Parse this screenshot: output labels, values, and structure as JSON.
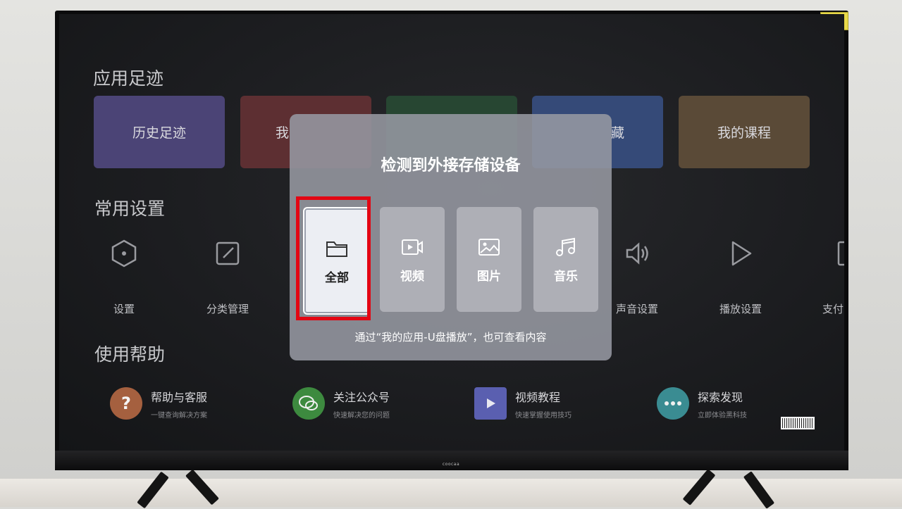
{
  "sections": {
    "recent": "应用足迹",
    "settings": "常用设置",
    "help": "使用帮助"
  },
  "recent_cards": [
    {
      "label": "历史足迹",
      "color": "#4b4476"
    },
    {
      "label": "我",
      "color": "#5d2f32"
    },
    {
      "label": "",
      "color": "#274632"
    },
    {
      "label": "藏",
      "color": "#354a78"
    },
    {
      "label": "我的课程",
      "color": "#5a4a37"
    }
  ],
  "settings_items": [
    {
      "label": "设置",
      "icon": "hexagon-icon"
    },
    {
      "label": "分类管理",
      "icon": "edit-square-icon"
    },
    {
      "label": "声音设置",
      "icon": "speaker-icon"
    },
    {
      "label": "播放设置",
      "icon": "play-icon"
    },
    {
      "label": "支付",
      "icon": "payment-icon"
    }
  ],
  "help_items": [
    {
      "title": "帮助与客服",
      "subtitle": "一键查询解决方案",
      "icon": "question-icon",
      "color": "#a5603f"
    },
    {
      "title": "关注公众号",
      "subtitle": "快速解决您的问题",
      "icon": "wechat-icon",
      "color": "#3d8a3f"
    },
    {
      "title": "视频教程",
      "subtitle": "快速掌握使用技巧",
      "icon": "video-tutorial-icon",
      "color": "#5a5fb0"
    },
    {
      "title": "探索发现",
      "subtitle": "立即体验黑科技",
      "icon": "explore-icon",
      "color": "#3a8c92"
    }
  ],
  "dialog": {
    "title": "检测到外接存储设备",
    "options": [
      {
        "label": "全部",
        "icon": "folder-icon",
        "selected": true
      },
      {
        "label": "视频",
        "icon": "video-icon",
        "selected": false
      },
      {
        "label": "图片",
        "icon": "image-icon",
        "selected": false
      },
      {
        "label": "音乐",
        "icon": "music-icon",
        "selected": false
      }
    ],
    "hint": "通过“我的应用-U盘播放”，也可查看内容"
  },
  "brand": "coocaa",
  "colors": {
    "highlight": "#e30613",
    "dialog_bg": "#979aa4"
  }
}
